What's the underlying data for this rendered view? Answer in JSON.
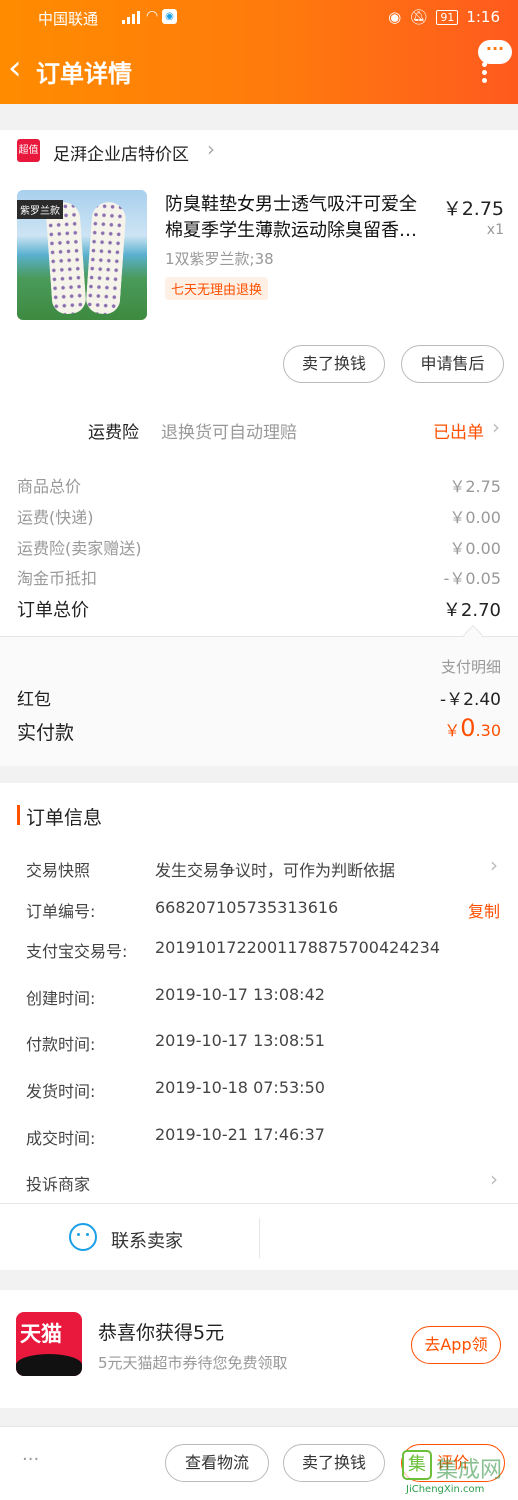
{
  "status_bar": {
    "carrier": "中国联通",
    "network": "4G",
    "battery": "91",
    "time": "1:16"
  },
  "header": {
    "title": "订单详情",
    "back_icon": "chevron-left-icon",
    "more_icon": "more-vertical-icon"
  },
  "shop": {
    "badge": "超值",
    "name": "足湃企业店特价区"
  },
  "item": {
    "thumb_tag": "紫罗兰款",
    "title": "防臭鞋垫女男士透气吸汗可爱全棉夏季学生薄款运动除臭留香…",
    "price": "￥2.75",
    "quantity": "x1",
    "sku": "1双紫罗兰款;38",
    "return_badge": "七天无理由退换"
  },
  "item_actions": {
    "sell_swap": "卖了换钱",
    "after_sale": "申请售后"
  },
  "insurance": {
    "label": "运费险",
    "desc": "退换货可自动理赔",
    "status": "已出单"
  },
  "costs": [
    {
      "label": "商品总价",
      "value": "￥2.75"
    },
    {
      "label": "运费(快递)",
      "value": "￥0.00"
    },
    {
      "label": "运费险(卖家赠送)",
      "value": "￥0.00"
    },
    {
      "label": "淘金币抵扣",
      "value": "-￥0.05"
    }
  ],
  "order_total": {
    "label": "订单总价",
    "value": "￥2.70"
  },
  "payment": {
    "detail_link": "支付明细",
    "red_packet_label": "红包",
    "red_packet_value": "-￥2.40",
    "paid_label": "实付款",
    "paid_symbol": "￥",
    "paid_int": "0",
    "paid_dec": ".30"
  },
  "order_info": {
    "heading": "订单信息",
    "snapshot_label": "交易快照",
    "snapshot_value": "发生交易争议时，可作为判断依据",
    "order_no_label": "订单编号:",
    "order_no_value": "668207105735313616",
    "copy": "复制",
    "alipay_label": "支付宝交易号:",
    "alipay_value": "2019101722001178875700424234",
    "created_label": "创建时间:",
    "created_value": "2019-10-17 13:08:42",
    "paid_label": "付款时间:",
    "paid_value": "2019-10-17 13:08:51",
    "shipped_label": "发货时间:",
    "shipped_value": "2019-10-18 07:53:50",
    "done_label": "成交时间:",
    "done_value": "2019-10-21 17:46:37",
    "complain": "投诉商家",
    "contact": "联系卖家"
  },
  "promo": {
    "logo_text": "天猫",
    "title": "恭喜你获得5元",
    "subtitle": "5元天猫超市券待您免费领取",
    "button": "去App领"
  },
  "bottom_bar": {
    "more": "···",
    "logistics": "查看物流",
    "sell_swap": "卖了换钱",
    "review": "评价"
  },
  "watermark": {
    "brand": "集成网",
    "url": "JiChengXin.com"
  },
  "colors": {
    "accent": "#ff5000",
    "header_start": "#ff8c00",
    "header_end": "#ff5a1e"
  }
}
